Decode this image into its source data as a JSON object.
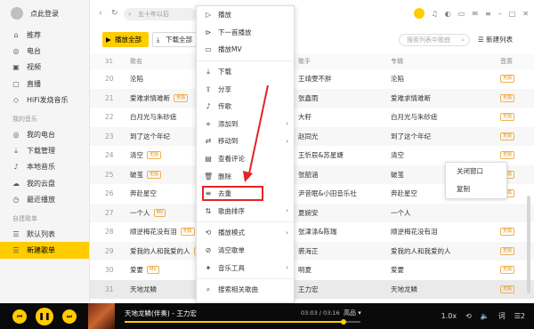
{
  "sidebar": {
    "login_label": "点此登录",
    "nav": [
      {
        "label": "推荐",
        "icon": "home-icon"
      },
      {
        "label": "电台",
        "icon": "radio-icon"
      },
      {
        "label": "视频",
        "icon": "video-icon"
      },
      {
        "label": "直播",
        "icon": "live-icon"
      },
      {
        "label": "HiFi发烧音乐",
        "icon": "hifi-icon"
      }
    ],
    "my_music_label": "我的音乐",
    "my_music": [
      {
        "label": "我的电台",
        "icon": "radio-icon"
      },
      {
        "label": "下载管理",
        "icon": "download-icon"
      },
      {
        "label": "本地音乐",
        "icon": "local-music-icon"
      },
      {
        "label": "我的云盘",
        "icon": "cloud-icon"
      },
      {
        "label": "最近播放",
        "icon": "clock-icon"
      }
    ],
    "playlists_label": "自建歌单",
    "playlists": [
      {
        "label": "默认列表",
        "icon": "list-icon"
      },
      {
        "label": "新建歌单",
        "icon": "list-icon"
      }
    ]
  },
  "topbar": {
    "back": "‹",
    "forward": "↻",
    "search_placeholder": "五十年以后",
    "icons": [
      "vip-icon",
      "headphones-icon",
      "skin-icon",
      "folder-icon",
      "message-icon",
      "settings-icon",
      "minimize-icon",
      "maximize-icon",
      "close-icon"
    ]
  },
  "toolbar": {
    "play_all": "播放全部",
    "download_all": "下载全部",
    "search_placeholder": "搜索列表中歌曲",
    "new_list": "新建列表"
  },
  "table": {
    "headers": {
      "num": "31",
      "title": "歌名",
      "singer": "歌手",
      "album": "专辑",
      "quality": "音质"
    },
    "rows": [
      {
        "num": "20",
        "title": "沦陷",
        "badge": "",
        "singer": "王靖雯不胖",
        "album": "沦陷",
        "q": "无损"
      },
      {
        "num": "21",
        "title": "爱难求情难断",
        "badge": "无损",
        "singer": "张鑫雨",
        "album": "爱难求情难断",
        "q": "无损"
      },
      {
        "num": "22",
        "title": "白月光与朱砂痣",
        "badge": "",
        "singer": "大籽",
        "album": "白月光与朱砂痣",
        "q": "无损"
      },
      {
        "num": "23",
        "title": "到了这个年纪",
        "badge": "",
        "singer": "赵同光",
        "album": "到了这个年纪",
        "q": "无损"
      },
      {
        "num": "24",
        "title": "清空",
        "badge": "无损",
        "singer": "王忻辰&苏星婕",
        "album": "清空",
        "q": "无损"
      },
      {
        "num": "25",
        "title": "破茧",
        "badge": "无损",
        "singer": "张韶涵",
        "album": "破茧",
        "q": "无损"
      },
      {
        "num": "26",
        "title": "奔赴星空",
        "badge": "",
        "singer": "尹昔眠&小田音乐社",
        "album": "奔赴星空",
        "q": "无损"
      },
      {
        "num": "27",
        "title": "一个人",
        "badge": "MV",
        "singer": "夏婉安",
        "album": "一个人",
        "q": ""
      },
      {
        "num": "28",
        "title": "顺逆梅花没有泪",
        "badge": "无损",
        "singer": "张津涤&陈瑞",
        "album": "顺逆梅花没有泪",
        "q": "无损"
      },
      {
        "num": "29",
        "title": "爱我的人和我爱的人",
        "badge": "MV",
        "singer": "裘海正",
        "album": "爱我的人和我爱的人",
        "q": "无损"
      },
      {
        "num": "30",
        "title": "爱要",
        "badge": "MV",
        "singer": "明夏",
        "album": "爱要",
        "q": "无损"
      },
      {
        "num": "31",
        "title": "天地龙鳞",
        "badge": "",
        "singer": "王力宏",
        "album": "天地龙鳞",
        "q": "无损"
      }
    ]
  },
  "context_menu": {
    "items": [
      {
        "label": "播放",
        "icon": "play-icon",
        "arrow": ""
      },
      {
        "label": "下一首播放",
        "icon": "next-play-icon",
        "arrow": ""
      },
      {
        "label": "播放MV",
        "icon": "mv-icon",
        "arrow": ""
      },
      {
        "sep": true
      },
      {
        "label": "下载",
        "icon": "download-icon",
        "arrow": ""
      },
      {
        "label": "分享",
        "icon": "share-icon",
        "arrow": ""
      },
      {
        "label": "传歌",
        "icon": "transfer-icon",
        "arrow": ""
      },
      {
        "label": "添加到",
        "icon": "add-icon",
        "arrow": "›"
      },
      {
        "label": "移动到",
        "icon": "move-icon",
        "arrow": "›"
      },
      {
        "label": "查看评论",
        "icon": "comment-icon",
        "arrow": ""
      },
      {
        "label": "删除",
        "icon": "trash-icon",
        "arrow": ""
      },
      {
        "label": "去重",
        "icon": "dedupe-icon",
        "arrow": "",
        "boxed": true
      },
      {
        "label": "歌曲排序",
        "icon": "sort-icon",
        "arrow": "›"
      },
      {
        "sep": true
      },
      {
        "label": "播放模式",
        "icon": "mode-icon",
        "arrow": "›"
      },
      {
        "label": "清空歌单",
        "icon": "clear-icon",
        "arrow": ""
      },
      {
        "label": "音乐工具",
        "icon": "tools-icon",
        "arrow": "›"
      },
      {
        "sep": true
      },
      {
        "label": "搜索相关歌曲",
        "icon": "search-icon",
        "arrow": ""
      }
    ]
  },
  "context_menu_2": {
    "items": [
      "关闭窗口",
      "复制"
    ]
  },
  "player": {
    "title": "天地龙鳞(伴奏) - 王力宏",
    "time": "03:03 / 03:16",
    "quality": "高品",
    "progress": 0.93,
    "speed": "1.0x",
    "extra": "2",
    "colors": {
      "accent": "#ffcc00",
      "bar": "#0a0a0a"
    }
  }
}
